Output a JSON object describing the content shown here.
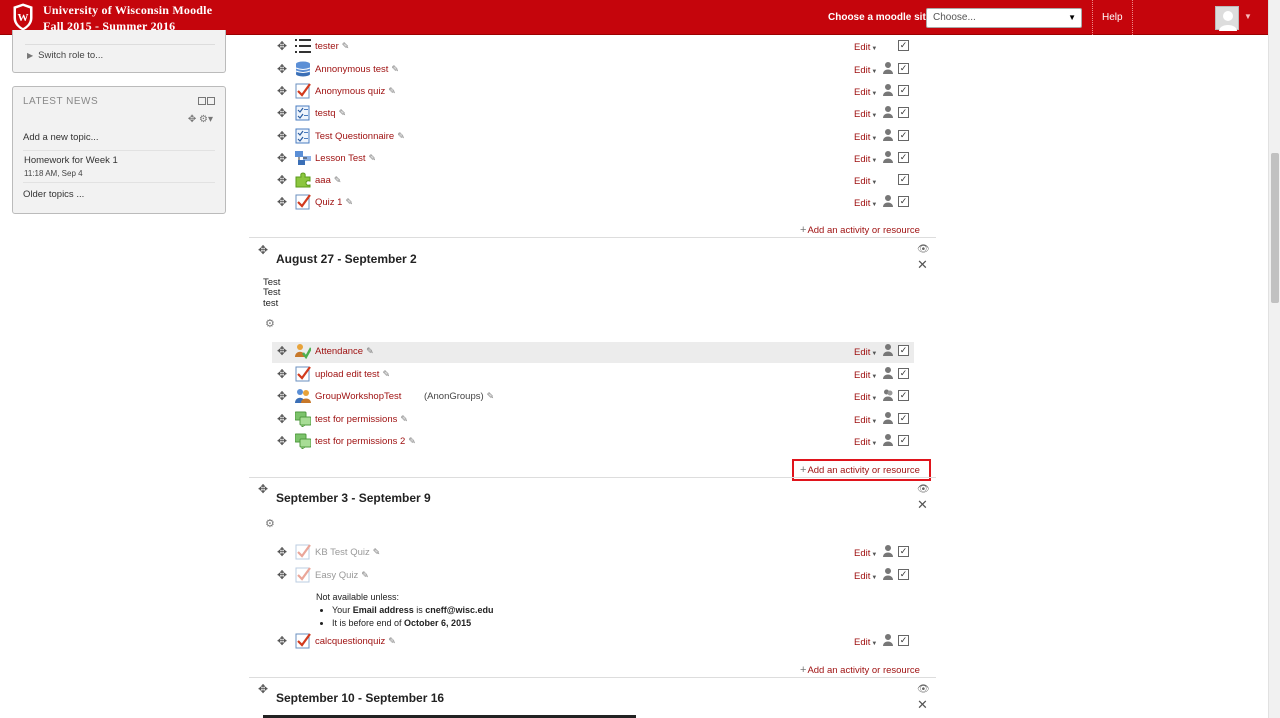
{
  "header": {
    "site_title_line1": "University of Wisconsin Moodle",
    "site_title_line2": "Fall 2015 - Summer 2016",
    "choose_label": "Choose a moodle site:",
    "site_select_value": "Choose...",
    "help_label": "Help",
    "brand_color": "#c5050c"
  },
  "sidebar": {
    "admin": {
      "switch_role": "Switch role to..."
    },
    "news": {
      "title": "LATEST NEWS",
      "add_topic": "Add a new topic...",
      "post_title": "Homework for Week 1",
      "post_date": "11:18 AM, Sep 4",
      "older": "Older topics ..."
    }
  },
  "labels": {
    "edit": "Edit",
    "add_activity": "Add an activity or resource"
  },
  "top_activities": [
    {
      "name": "tester",
      "icon": "list-icon"
    },
    {
      "name": "Annonymous test",
      "icon": "database-icon"
    },
    {
      "name": "Anonymous quiz",
      "icon": "quiz-icon"
    },
    {
      "name": "testq",
      "icon": "questionnaire-icon"
    },
    {
      "name": "Test Questionnaire",
      "icon": "questionnaire-icon"
    },
    {
      "name": "Lesson Test",
      "icon": "lesson-icon"
    },
    {
      "name": "aaa",
      "icon": "puzzle-icon"
    },
    {
      "name": "Quiz 1",
      "icon": "quiz-icon"
    }
  ],
  "section1": {
    "title": "August 27 - September 2",
    "summary": [
      "Test",
      "Test",
      "test"
    ],
    "activities": [
      {
        "name": "Attendance",
        "icon": "attendance-icon"
      },
      {
        "name": "upload edit test",
        "icon": "quiz-icon"
      },
      {
        "name": "GroupWorkshopTest",
        "icon": "workshop-icon",
        "extra": "(AnonGroups)"
      },
      {
        "name": "test for permissions",
        "icon": "forum-icon"
      },
      {
        "name": "test for permissions 2",
        "icon": "forum-icon"
      }
    ]
  },
  "section2": {
    "title": "September 3 - September 9",
    "activities": [
      {
        "name": "KB Test Quiz",
        "icon": "quiz-icon"
      },
      {
        "name": "Easy Quiz",
        "icon": "quiz-icon"
      },
      {
        "name": "calcquestionquiz",
        "icon": "quiz-icon"
      }
    ],
    "restriction": {
      "intro": "Not available unless:",
      "cond1_pre": "Your ",
      "cond1_field": "Email address",
      "cond1_mid": " is ",
      "cond1_value": "cneff@wisc.edu",
      "cond2_pre": "It is before end of ",
      "cond2_value": "October 6, 2015"
    }
  },
  "section3": {
    "title": "September 10 - September 16"
  }
}
